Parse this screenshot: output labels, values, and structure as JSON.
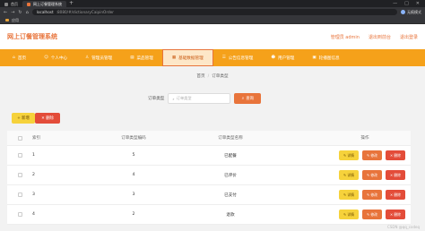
{
  "browser": {
    "tabs": [
      {
        "label": "首页",
        "active": false
      },
      {
        "label": "网上订餐管理系统",
        "active": true
      }
    ],
    "new_tab_glyph": "+",
    "window_controls": [
      "—",
      "□",
      "✕"
    ],
    "nav_glyphs": [
      "←",
      "→",
      "↻",
      "⌂"
    ],
    "url_host": "localhost",
    "url_path": ":8080/#/dictionaryCaipinOrder",
    "profile_label": "无痕模式",
    "bookmark_label": "应用"
  },
  "app": {
    "title": "网上订餐管理系统",
    "header_links": [
      "管理员 admin",
      "退出到前台",
      "退出登录"
    ]
  },
  "nav": {
    "items": [
      {
        "label": "首页",
        "icon": "home-icon",
        "glyph": "⌂",
        "active": false
      },
      {
        "label": "个人中心",
        "icon": "user-icon",
        "glyph": "☺",
        "active": false
      },
      {
        "label": "管理员管理",
        "icon": "admin-icon",
        "glyph": "♙",
        "active": false
      },
      {
        "label": "菜品管理",
        "icon": "dish-icon",
        "glyph": "▤",
        "active": false
      },
      {
        "label": "基础数据管理",
        "icon": "data-icon",
        "glyph": "▦",
        "active": true
      },
      {
        "label": "公告信息管理",
        "icon": "notice-icon",
        "glyph": "☰",
        "active": false
      },
      {
        "label": "用户管理",
        "icon": "users-icon",
        "glyph": "☻",
        "active": false
      },
      {
        "label": "轮播图信息",
        "icon": "image-icon",
        "glyph": "▣",
        "active": false
      }
    ]
  },
  "breadcrumb": {
    "home": "首页",
    "separator": "/",
    "current": "订单类型"
  },
  "search": {
    "label": "订单类型",
    "placeholder": "订单类型",
    "button_label": "查询"
  },
  "actions": {
    "add_label": "+ 新增",
    "delete_label": "✕ 删除"
  },
  "table": {
    "columns": [
      "",
      "索引",
      "订单类型编码",
      "订单类型名称",
      "",
      "操作"
    ],
    "op_labels": {
      "detail": "✎ 详情",
      "edit": "✎ 修改",
      "remove": "✕ 删除"
    },
    "rows": [
      {
        "index": "1",
        "code": "5",
        "name": "已配餐"
      },
      {
        "index": "2",
        "code": "4",
        "name": "已评价"
      },
      {
        "index": "3",
        "code": "3",
        "name": "已支付"
      },
      {
        "index": "4",
        "code": "2",
        "name": "退款"
      }
    ]
  },
  "watermark": "CSDN @qq_codeq",
  "colors": {
    "accent": "#e8743b",
    "nav_bg": "#f5a11a",
    "detail": "#f6d23b",
    "delete": "#e34c39"
  }
}
